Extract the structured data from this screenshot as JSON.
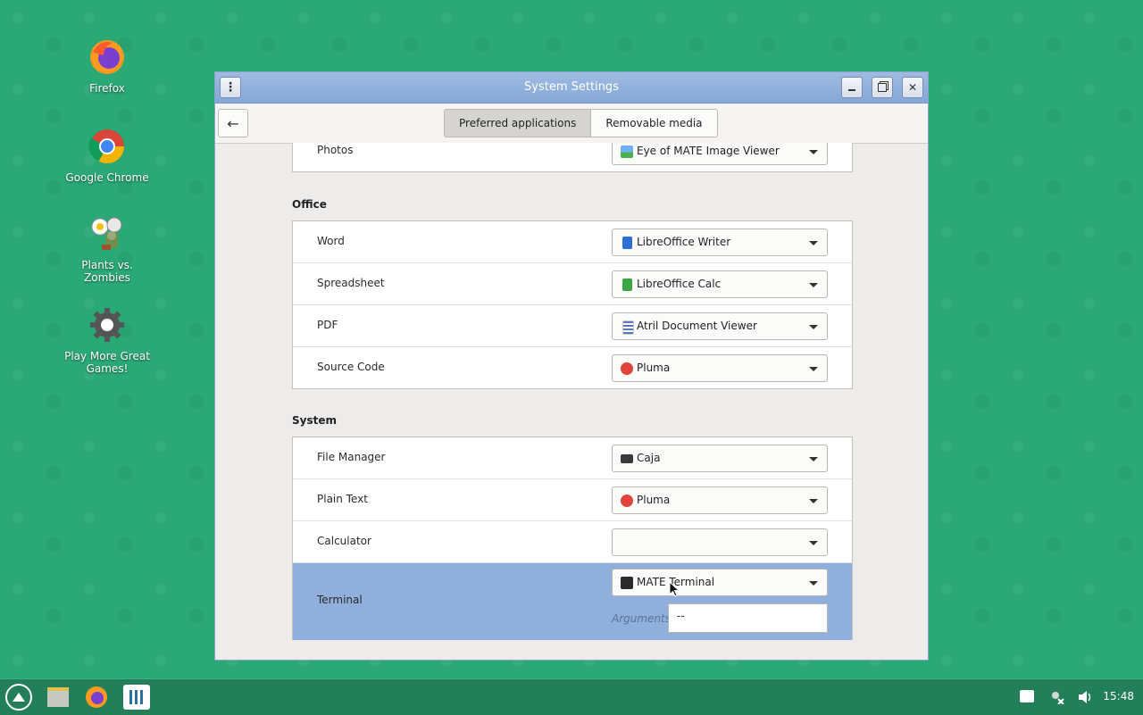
{
  "desktop": {
    "icons": [
      {
        "label": "Firefox"
      },
      {
        "label": "Google Chrome"
      },
      {
        "label": "Plants vs. Zombies"
      },
      {
        "label": "Play More Great Games!"
      }
    ]
  },
  "window": {
    "title": "System Settings",
    "tabs": [
      {
        "label": "Preferred applications",
        "active": true
      },
      {
        "label": "Removable media",
        "active": false
      }
    ],
    "sections": [
      {
        "title": "",
        "rows": [
          {
            "label": "Photos",
            "app": "Eye of MATE Image Viewer",
            "icon": "image-viewer-icon"
          }
        ]
      },
      {
        "title": "Office",
        "rows": [
          {
            "label": "Word",
            "app": "LibreOffice Writer",
            "icon": "writer-icon"
          },
          {
            "label": "Spreadsheet",
            "app": "LibreOffice Calc",
            "icon": "calc-icon"
          },
          {
            "label": "PDF",
            "app": "Atril Document Viewer",
            "icon": "document-viewer-icon"
          },
          {
            "label": "Source Code",
            "app": "Pluma",
            "icon": "pluma-icon"
          }
        ]
      },
      {
        "title": "System",
        "rows": [
          {
            "label": "File Manager",
            "app": "Caja",
            "icon": "folder-icon"
          },
          {
            "label": "Plain Text",
            "app": "Pluma",
            "icon": "pluma-icon"
          },
          {
            "label": "Calculator",
            "app": "",
            "icon": ""
          },
          {
            "label": "Terminal",
            "app": "MATE Terminal",
            "icon": "terminal-icon",
            "arguments_label": "Arguments",
            "arguments_value": "--"
          }
        ]
      }
    ]
  },
  "taskbar": {
    "time": "15:48"
  },
  "colors": {
    "desktop": "#2aa876",
    "selection": "#8fb0dc",
    "titlebar": "#86a7d7"
  }
}
